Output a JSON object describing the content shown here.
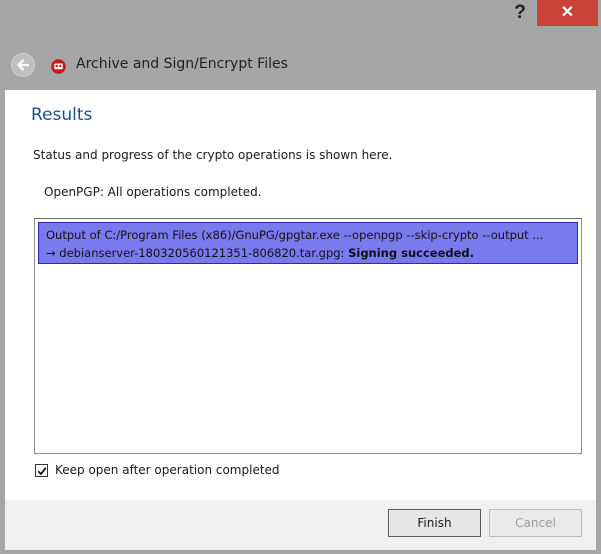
{
  "titlebar": {
    "help_label": "?",
    "close_label": "✕"
  },
  "header": {
    "back_icon": "back-arrow-icon",
    "app_icon": "kleopatra-icon",
    "title": "Archive and Sign/Encrypt Files"
  },
  "page": {
    "title": "Results",
    "subtitle": "Status and progress of the crypto operations is shown here.",
    "status": "OpenPGP: All operations completed."
  },
  "log": {
    "items": [
      {
        "line1": "Output of C:/Program Files (x86)/GnuPG/gpgtar.exe --openpgp --skip-crypto --output ...",
        "line2_prefix": "→ debianserver-180320560121351-806820.tar.gpg: ",
        "line2_result": "Signing succeeded."
      }
    ]
  },
  "options": {
    "keep_open_label": "Keep open after operation completed",
    "keep_open_checked": true
  },
  "buttons": {
    "finish_label": "Finish",
    "cancel_label": "Cancel"
  },
  "colors": {
    "title_blue": "#1b4e95",
    "selection": "#7a7aef",
    "close_red": "#c8423a"
  }
}
